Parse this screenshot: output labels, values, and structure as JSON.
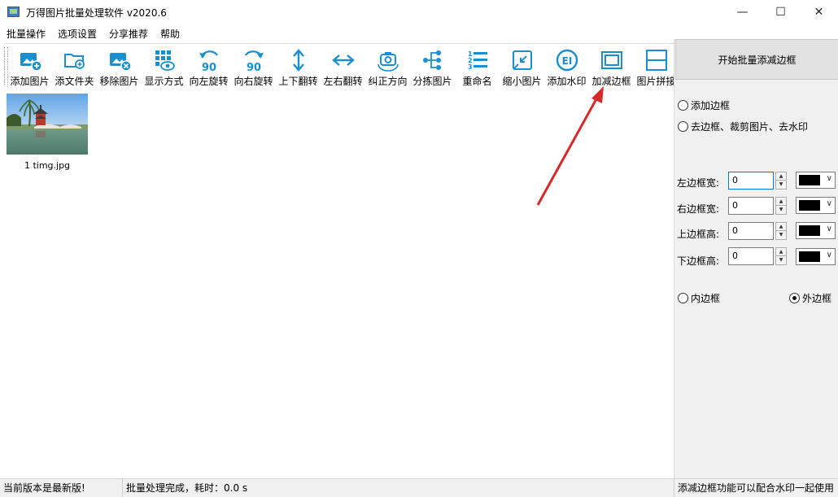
{
  "window": {
    "title": "万得图片批量处理软件 v2020.6",
    "minimize": "—",
    "maximize": "☐",
    "close": "✕"
  },
  "menu": [
    "批量操作",
    "选项设置",
    "分享推荐",
    "帮助"
  ],
  "toolbar": [
    {
      "label": "添加图片",
      "icon": "add-image-icon"
    },
    {
      "label": "添文件夹",
      "icon": "add-folder-icon"
    },
    {
      "label": "移除图片",
      "icon": "remove-image-icon"
    },
    {
      "label": "显示方式",
      "icon": "view-mode-icon"
    },
    {
      "label": "向左旋转",
      "icon": "rotate-left-icon"
    },
    {
      "label": "向右旋转",
      "icon": "rotate-right-icon"
    },
    {
      "label": "上下翻转",
      "icon": "flip-vertical-icon"
    },
    {
      "label": "左右翻转",
      "icon": "flip-horizontal-icon"
    },
    {
      "label": "纠正方向",
      "icon": "correct-orientation-icon"
    },
    {
      "label": "分拣图片",
      "icon": "sort-images-icon"
    },
    {
      "label": "重命名",
      "icon": "rename-icon"
    },
    {
      "label": "缩小图片",
      "icon": "shrink-image-icon"
    },
    {
      "label": "添加水印",
      "icon": "watermark-icon"
    },
    {
      "label": "加减边框",
      "icon": "border-icon"
    },
    {
      "label": "图片拼接",
      "icon": "stitch-icon"
    }
  ],
  "rotate_degrees": "90",
  "watermark_icon_text": "EI",
  "images": [
    {
      "caption": "1 timg.jpg"
    }
  ],
  "panel": {
    "start_button": "开始批量添减边框",
    "mode_add": "添加边框",
    "mode_remove": "去边框、裁剪图片、去水印",
    "left_label": "左边框宽:",
    "right_label": "右边框宽:",
    "top_label": "上边框高:",
    "bottom_label": "下边框高:",
    "left_value": "0",
    "right_value": "0",
    "top_value": "0",
    "bottom_value": "0",
    "inner_border": "内边框",
    "outer_border": "外边框",
    "border_color": "#000000"
  },
  "status": {
    "version": "当前版本是最新版!",
    "process": "批量处理完成，耗时：0.0 s",
    "tip": "添减边框功能可以配合水印一起使用"
  },
  "accent": "#1a8fd0"
}
